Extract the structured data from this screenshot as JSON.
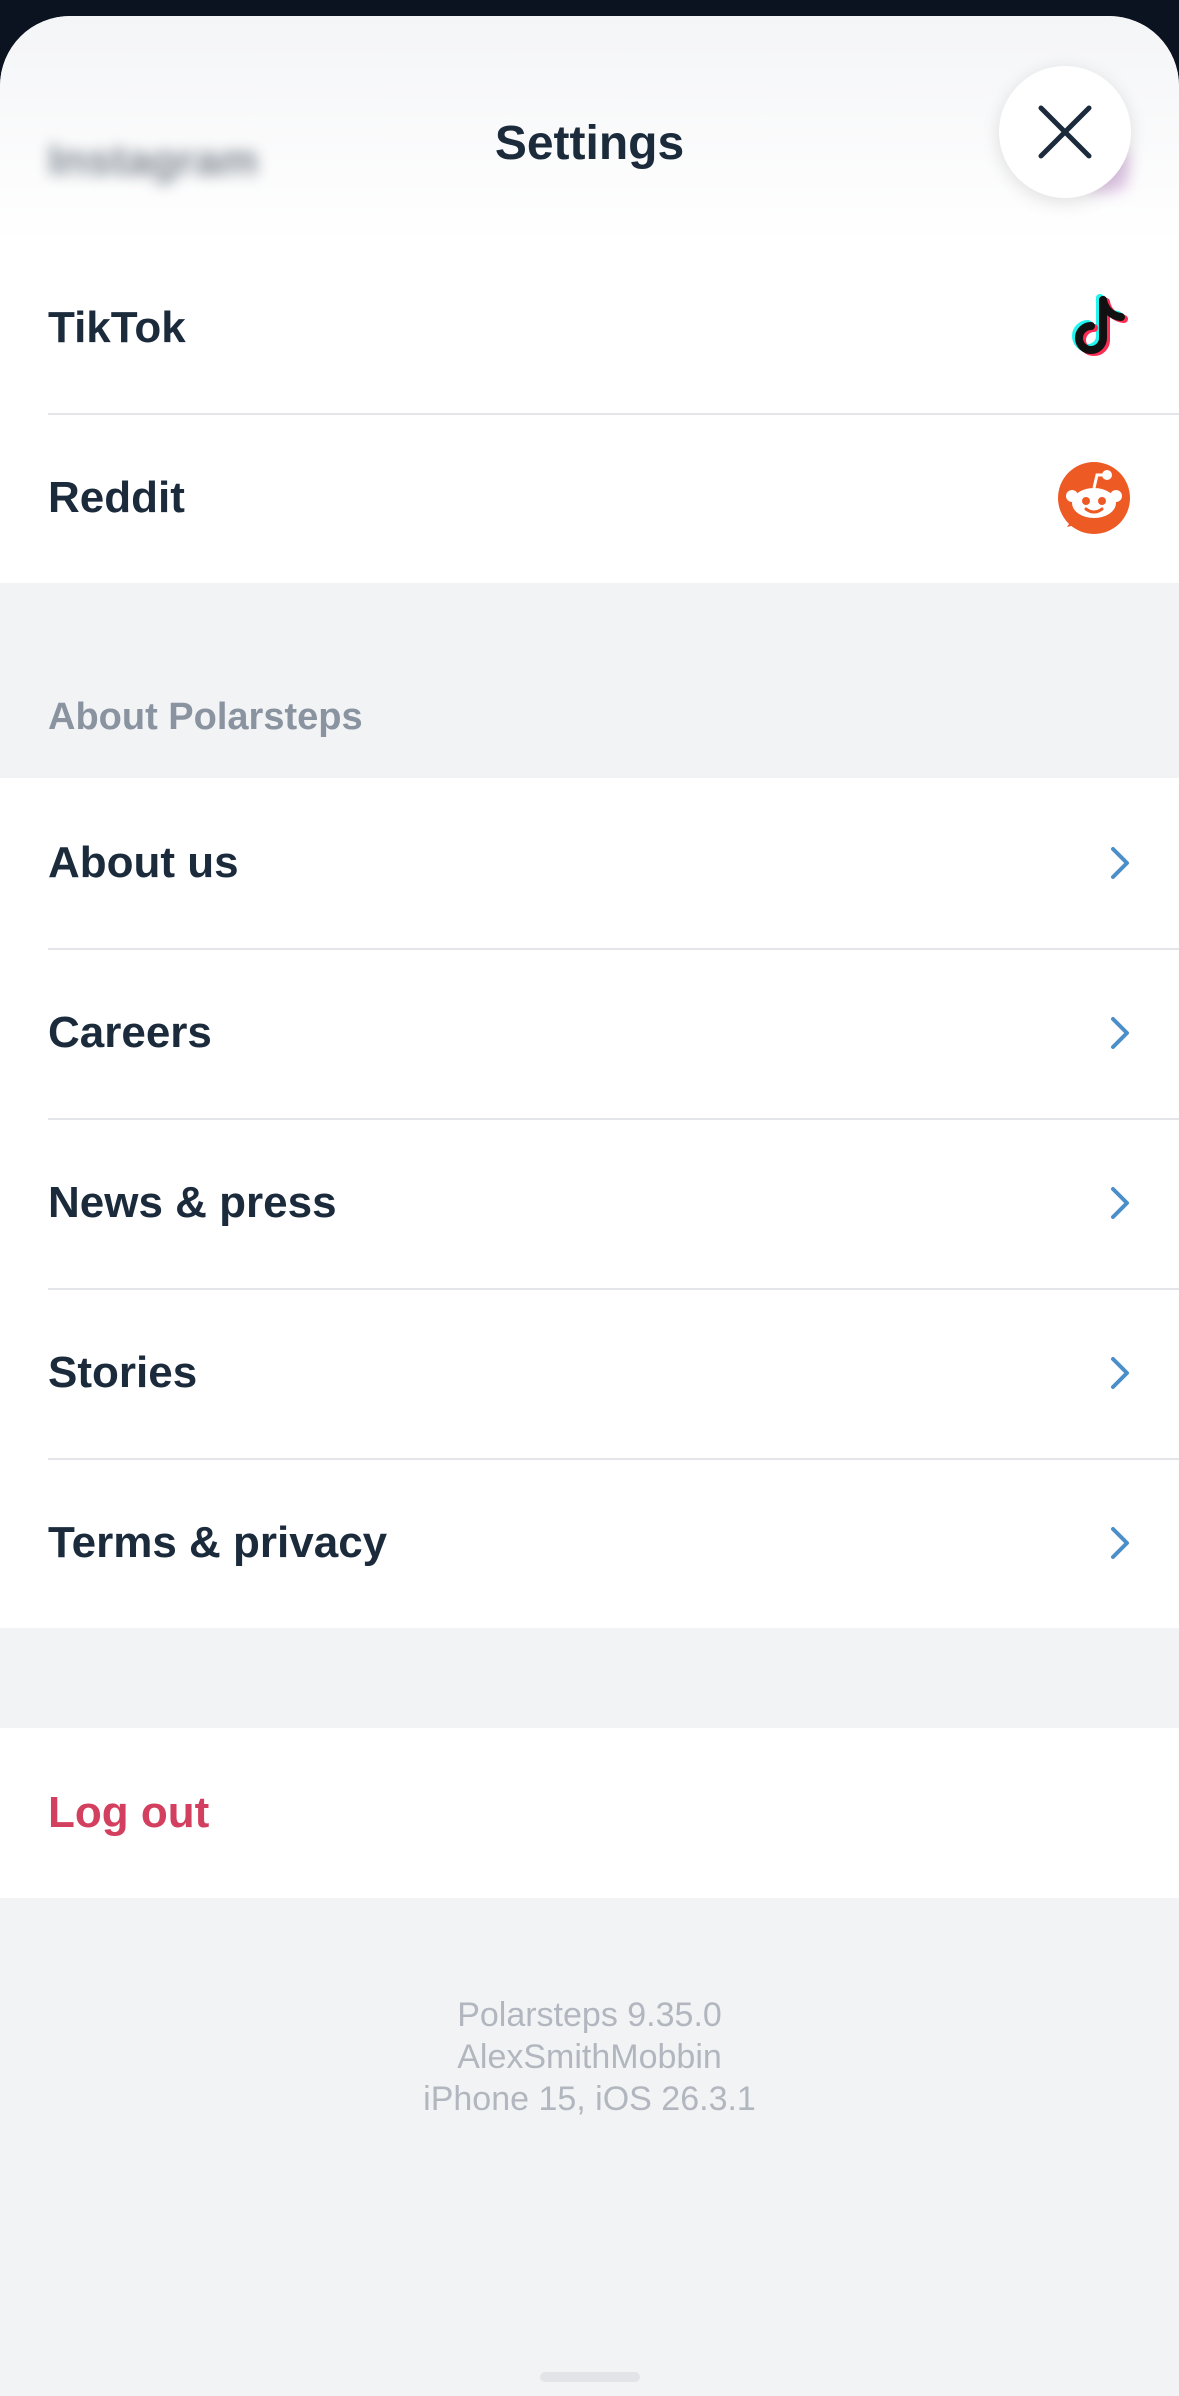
{
  "header": {
    "title": "Settings"
  },
  "social": {
    "items": [
      {
        "label": "Instagram",
        "icon": "instagram-icon"
      },
      {
        "label": "TikTok",
        "icon": "tiktok-icon"
      },
      {
        "label": "Reddit",
        "icon": "reddit-icon"
      }
    ]
  },
  "about": {
    "header": "About Polarsteps",
    "items": [
      {
        "label": "About us",
        "icon": "chevron-right-icon"
      },
      {
        "label": "Careers",
        "icon": "chevron-right-icon"
      },
      {
        "label": "News & press",
        "icon": "chevron-right-icon"
      },
      {
        "label": "Stories",
        "icon": "chevron-right-icon"
      },
      {
        "label": "Terms & privacy",
        "icon": "chevron-right-icon"
      }
    ]
  },
  "account": {
    "logout_label": "Log out"
  },
  "footer": {
    "version": "Polarsteps 9.35.0",
    "username": "AlexSmithMobbin",
    "device": "iPhone 15, iOS 26.3.1"
  },
  "colors": {
    "text": "#1b2b3c",
    "chevron": "#4b8ec8",
    "logout": "#d33f5e",
    "reddit": "#ee5a24",
    "background": "#f2f3f5"
  }
}
